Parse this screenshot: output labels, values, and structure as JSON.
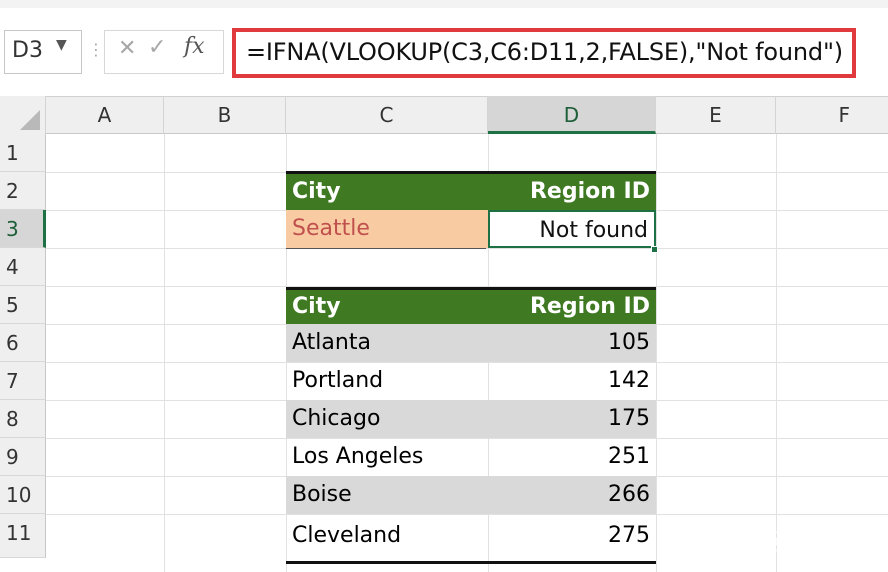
{
  "formula_bar": {
    "name_box": "D3",
    "formula": "=IFNA(VLOOKUP(C3,C6:D11,2,FALSE),\"Not found\")"
  },
  "columns": [
    "A",
    "B",
    "C",
    "D",
    "E",
    "F"
  ],
  "rows": [
    "1",
    "2",
    "3",
    "4",
    "5",
    "6",
    "7",
    "8",
    "9",
    "10",
    "11"
  ],
  "lookup_table": {
    "header_city": "City",
    "header_region": "Region ID",
    "input_city": "Seattle",
    "result": "Not found"
  },
  "data_table": {
    "header_city": "City",
    "header_region": "Region ID",
    "rows": [
      {
        "city": "Atlanta",
        "id": "105"
      },
      {
        "city": "Portland",
        "id": "142"
      },
      {
        "city": "Chicago",
        "id": "175"
      },
      {
        "city": "Los Angeles",
        "id": "251"
      },
      {
        "city": "Boise",
        "id": "266"
      },
      {
        "city": "Cleveland",
        "id": "275"
      }
    ]
  },
  "watermark": "知乎 @伙伴云",
  "colors": {
    "header_green": "#3f7a22",
    "input_orange": "#f8cba3",
    "stripe_grey": "#d9d9d9",
    "selection_green": "#1e7145",
    "formula_highlight_red": "#e0393e"
  }
}
